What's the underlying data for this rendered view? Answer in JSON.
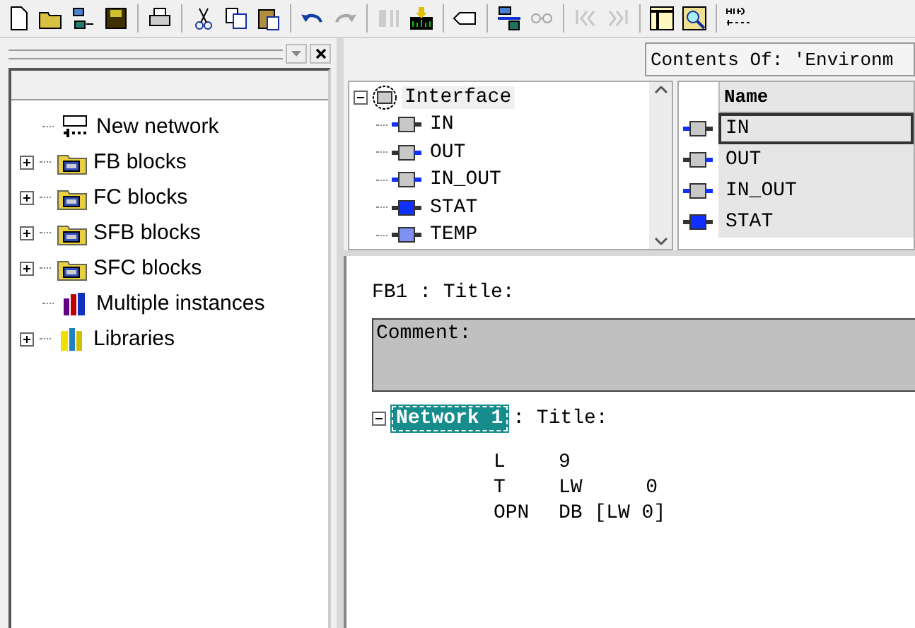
{
  "toolbar": [
    [
      {
        "kind": "new",
        "disabled": false
      },
      {
        "kind": "open",
        "disabled": false
      },
      {
        "kind": "network",
        "disabled": false
      },
      {
        "kind": "save",
        "disabled": false
      }
    ],
    [
      {
        "kind": "print",
        "disabled": false
      }
    ],
    [
      {
        "kind": "cut",
        "disabled": false
      },
      {
        "kind": "copy",
        "disabled": false
      },
      {
        "kind": "paste",
        "disabled": false
      }
    ],
    [
      {
        "kind": "undo",
        "disabled": false
      },
      {
        "kind": "redo",
        "disabled": true
      }
    ],
    [
      {
        "kind": "compare",
        "disabled": true
      },
      {
        "kind": "download",
        "disabled": false
      }
    ],
    [
      {
        "kind": "tag",
        "disabled": false
      }
    ],
    [
      {
        "kind": "station",
        "disabled": false
      },
      {
        "kind": "glasses",
        "disabled": true
      }
    ],
    [
      {
        "kind": "first",
        "disabled": true
      },
      {
        "kind": "last",
        "disabled": true
      }
    ],
    [
      {
        "kind": "panel",
        "disabled": false
      },
      {
        "kind": "zoom",
        "disabled": false
      }
    ],
    [
      {
        "kind": "contact",
        "disabled": false
      }
    ]
  ],
  "catalog": {
    "items": [
      {
        "label": "New network",
        "kind": "network",
        "expandable": false
      },
      {
        "label": "FB blocks",
        "kind": "folder",
        "expandable": true
      },
      {
        "label": "FC blocks",
        "kind": "folder",
        "expandable": true
      },
      {
        "label": "SFB blocks",
        "kind": "folder",
        "expandable": true
      },
      {
        "label": "SFC blocks",
        "kind": "folder",
        "expandable": true
      },
      {
        "label": "Multiple instances",
        "kind": "instances",
        "expandable": false
      },
      {
        "label": "Libraries",
        "kind": "libraries",
        "expandable": true
      }
    ]
  },
  "contents_header": "Contents Of: 'Environm",
  "interface": {
    "label": "Interface",
    "expanded": true,
    "selected": true,
    "children": [
      {
        "label": "IN",
        "kind": "in",
        "selected": false
      },
      {
        "label": "OUT",
        "kind": "out",
        "selected": false
      },
      {
        "label": "IN_OUT",
        "kind": "inout",
        "selected": false
      },
      {
        "label": "STAT",
        "kind": "stat",
        "selected": false
      },
      {
        "label": "TEMP",
        "kind": "temp",
        "selected": false
      }
    ]
  },
  "table": {
    "column": "Name",
    "rows": [
      {
        "name": "IN",
        "kind": "in",
        "selected": true
      },
      {
        "name": "OUT",
        "kind": "out",
        "selected": false
      },
      {
        "name": "IN_OUT",
        "kind": "inout",
        "selected": false
      },
      {
        "name": "STAT",
        "kind": "stat",
        "selected": false
      }
    ]
  },
  "code": {
    "block_title": "FB1 : Title:",
    "comment": "Comment:",
    "network": {
      "label": "Network 1",
      "selected": true,
      "expanded": true,
      "title": ": Title:"
    },
    "lines": [
      {
        "op": "L",
        "operand": "9"
      },
      {
        "op": "T",
        "operand": "LW",
        "extra": "0"
      },
      {
        "op": "OPN",
        "operand": "DB [LW 0]"
      }
    ]
  }
}
